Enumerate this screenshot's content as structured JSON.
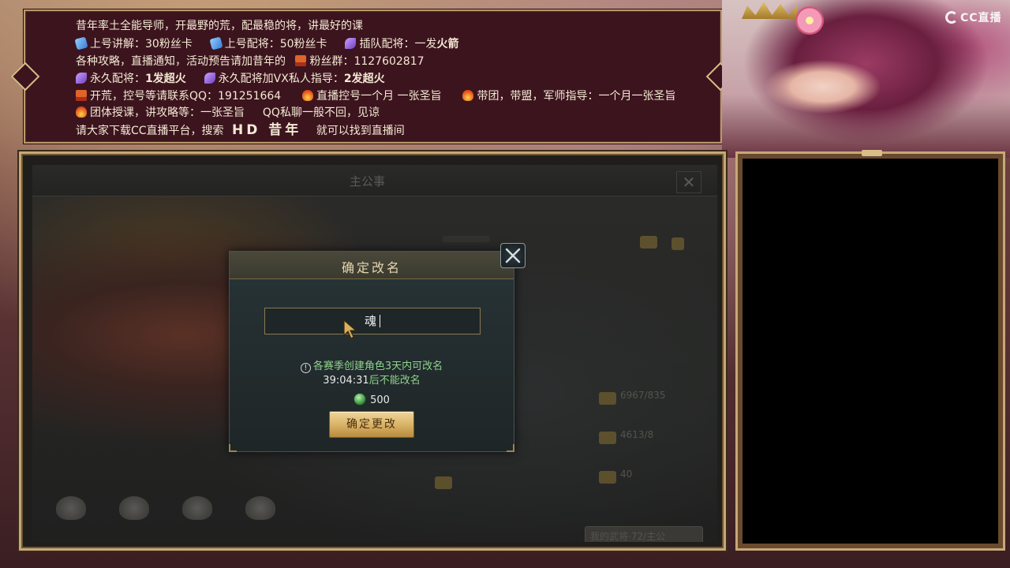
{
  "announcement": {
    "line1": "昔年率土全能导师，开最野的荒，配最稳的将，讲最好的课",
    "line2_a": "上号讲解：30粉丝卡",
    "line2_b": "上号配将：50粉丝卡",
    "line2_c": "插队配将：一发",
    "line2_c_bold": "火箭",
    "line3_a": "各种攻略，直播通知，活动预告请加昔年的",
    "line3_b": "粉丝群：1127602817",
    "line4_a": "永久配将：",
    "line4_a_bold": "1发超火",
    "line4_b": "永久配将加VX私人指导：",
    "line4_b_bold": "2发超火",
    "line5_a": "开荒，控号等请联系QQ：191251664",
    "line5_b": "直播控号一个月 一张圣旨",
    "line5_c": "带团，带盟，军师指导：一个月一张圣旨",
    "line6_a": "团体授课，讲攻略等：一张圣旨",
    "line6_b": "QQ私聊一般不回，见谅",
    "line7_a": "请大家下载CC直播平台，搜索",
    "line7_b": "HD 昔年",
    "line7_c": "就可以找到直播间"
  },
  "platform": {
    "logo_text": "CC直播"
  },
  "game": {
    "blurred_title": "主公事",
    "blurred_numbers": [
      "6967/835",
      "4613/8",
      "40"
    ],
    "blurred_footer": "我的武将·72/主公"
  },
  "modal": {
    "title": "确定改名",
    "input_value": "魂",
    "notice": "各赛季创建角色3天内可改名",
    "countdown": "39:04:31",
    "countdown_suffix": "后不能改名",
    "cost": "500",
    "confirm_label": "确定更改"
  },
  "colors": {
    "announce_bg": "#3c141e",
    "frame_gold": "#c6a878",
    "notice_green": "#8fd28c",
    "button_gold": "#d9b468"
  }
}
